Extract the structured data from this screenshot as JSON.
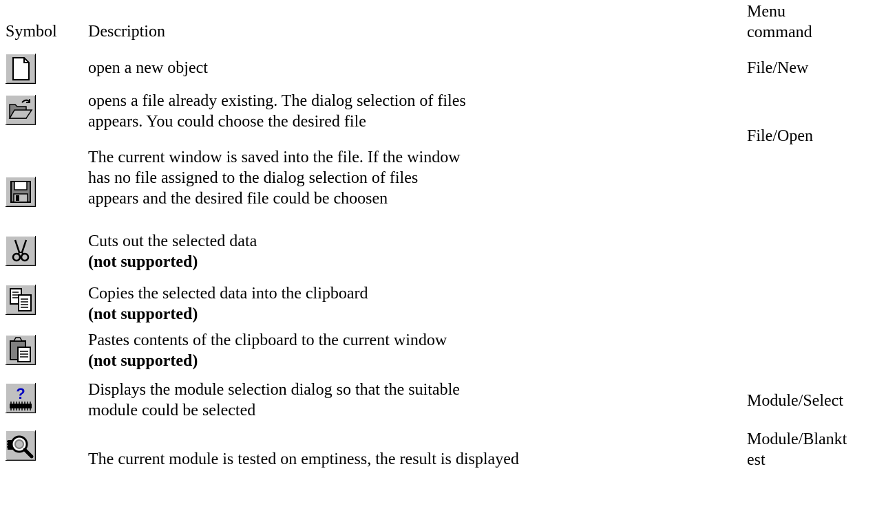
{
  "header": {
    "symbol": "Symbol",
    "description": "Description",
    "menu_line1": "Menu",
    "menu_line2": "command"
  },
  "rows": [
    {
      "icon": "new-file-icon",
      "description": "open a new object",
      "note": "",
      "menu": "File/New",
      "menu2": ""
    },
    {
      "icon": "open-folder-icon",
      "description": "opens a file already existing. The dialog selection of files appears. You could choose the desired file",
      "note": "",
      "menu": "File/Open",
      "menu2": ""
    },
    {
      "icon": "save-disk-icon",
      "description": "The current window is saved into the file. If the window has no file assigned to the dialog selection of files appears and the desired file could be choosen",
      "note": "",
      "menu": "",
      "menu2": ""
    },
    {
      "icon": "scissors-cut-icon",
      "description": "Cuts out the selected data",
      "note": "(not supported)",
      "menu": "",
      "menu2": ""
    },
    {
      "icon": "copy-icon",
      "description": "Copies the selected data into the clipboard",
      "note": "(not supported)",
      "menu": "",
      "menu2": ""
    },
    {
      "icon": "paste-clipboard-icon",
      "description": "Pastes contents of the clipboard to the current window",
      "note": "(not supported)",
      "menu": "",
      "menu2": ""
    },
    {
      "icon": "module-select-icon",
      "description": "Displays the module selection dialog so that the suitable module could be selected",
      "note": "",
      "menu": "Module/Select",
      "menu2": ""
    },
    {
      "icon": "blank-test-icon",
      "description": "The current module is tested on emptiness, the result is displayed",
      "note": "",
      "menu": "Module/Blankt",
      "menu2": "est"
    }
  ]
}
